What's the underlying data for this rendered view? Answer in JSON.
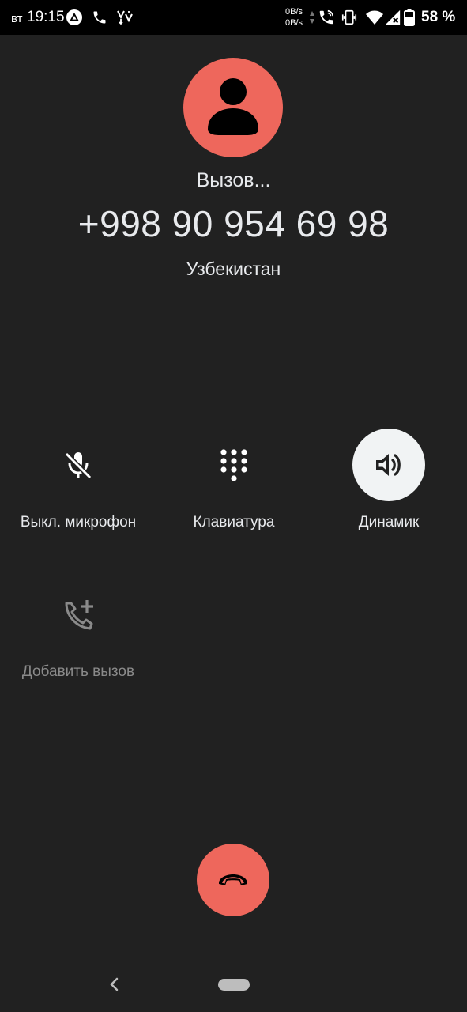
{
  "status_bar": {
    "day": "вт",
    "time": "19:15",
    "net_up": "0B/s",
    "net_down": "0B/s",
    "battery_pct": "58 %",
    "icons": [
      "app-notification-icon",
      "phone-icon",
      "signal-activity-icon",
      "wifi-call-icon",
      "vibrate-icon",
      "wifi-icon",
      "no-signal-icon",
      "battery-icon"
    ]
  },
  "call": {
    "status": "Вызов...",
    "number": "+998 90 954 69 98",
    "location": "Узбекистан",
    "avatar_color": "#ee675c"
  },
  "controls": {
    "mute_label": "Выкл. микрофон",
    "keypad_label": "Клавиатура",
    "speaker_label": "Динамик",
    "add_call_label": "Добавить вызов"
  },
  "colors": {
    "background": "#212121",
    "end_call": "#ee675c",
    "speaker_active": "#f1f3f4"
  }
}
